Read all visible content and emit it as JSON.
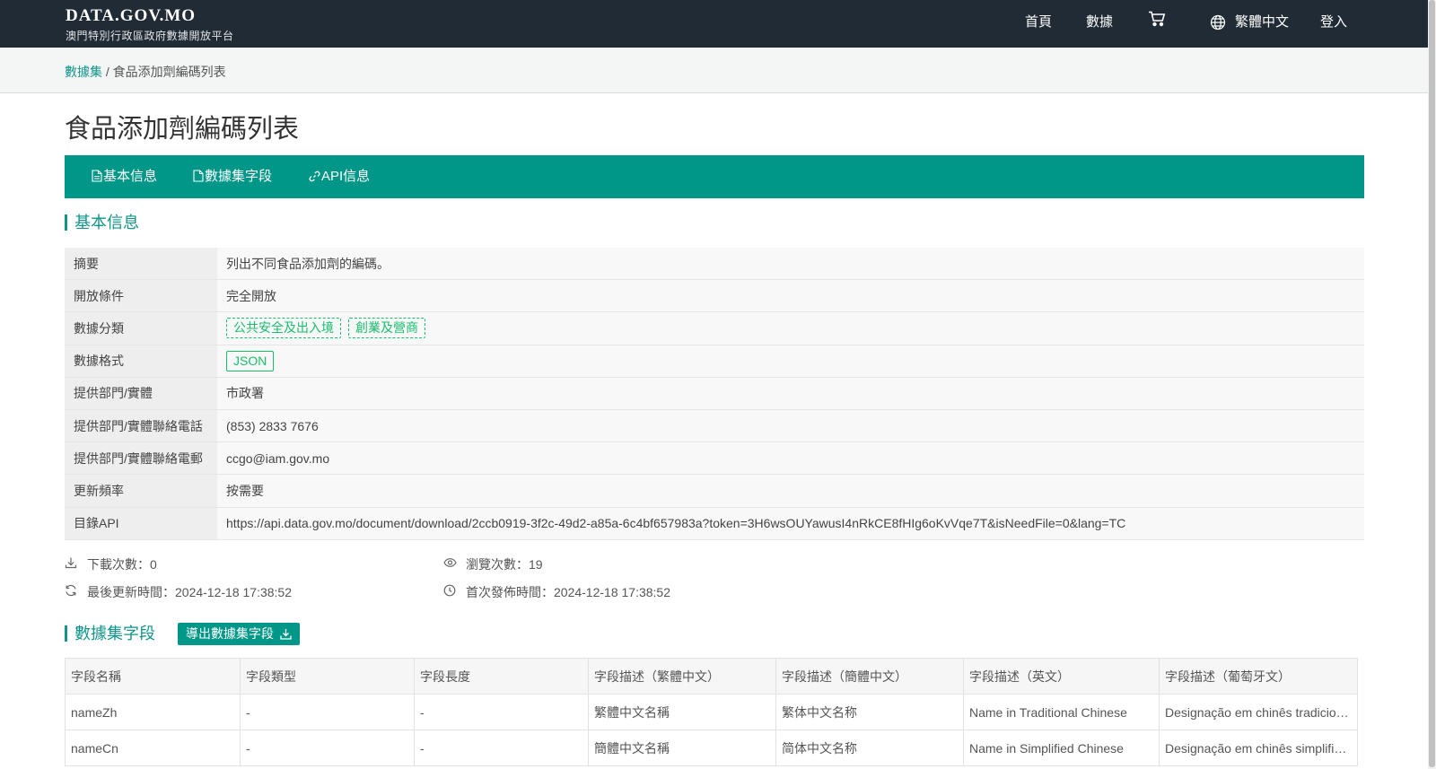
{
  "header": {
    "brand_title": "DATA.GOV.MO",
    "brand_subtitle": "澳門特別行政區政府數據開放平台",
    "nav_home": "首頁",
    "nav_data": "數據",
    "cart_icon": "cart-icon",
    "lang_icon": "globe-icon",
    "nav_lang": "繁體中文",
    "nav_login": "登入"
  },
  "breadcrumb": {
    "root": "數據集",
    "separator": " / ",
    "current": "食品添加劑編碼列表"
  },
  "page": {
    "title": "食品添加劑編碼列表"
  },
  "tabs": [
    {
      "label": "基本信息",
      "icon": "document-icon"
    },
    {
      "label": "數據集字段",
      "icon": "document-text-icon"
    },
    {
      "label": "API信息",
      "icon": "link-icon"
    }
  ],
  "basic": {
    "heading": "基本信息",
    "rows": {
      "summary": {
        "label": "摘要",
        "value": "列出不同食品添加劑的編碼。"
      },
      "condition": {
        "label": "開放條件",
        "value": "完全開放"
      },
      "category": {
        "label": "數據分類",
        "tags": [
          "公共安全及出入境",
          "創業及營商"
        ]
      },
      "format": {
        "label": "數據格式",
        "tags": [
          "JSON"
        ]
      },
      "provider": {
        "label": "提供部門/實體",
        "value": "市政署"
      },
      "phone": {
        "label": "提供部門/實體聯絡電話",
        "value": "(853) 2833 7676"
      },
      "email": {
        "label": "提供部門/實體聯絡電郵",
        "value": "ccgo@iam.gov.mo"
      },
      "frequency": {
        "label": "更新頻率",
        "value": "按需要"
      },
      "api": {
        "label": "目錄API",
        "value": "https://api.data.gov.mo/document/download/2ccb0919-3f2c-49d2-a85a-6c4bf657983a?token=3H6wsOUYawusI4nRkCE8fHIg6oKvVqe7T&isNeedFile=0&lang=TC"
      }
    }
  },
  "stats": {
    "downloads": "下載次數：0",
    "views": "瀏覽次數：19",
    "last_updated": "最後更新時間：2024-12-18 17:38:52",
    "first_published": "首次發佈時間：2024-12-18 17:38:52"
  },
  "fields": {
    "heading": "數據集字段",
    "export_label": "導出數據集字段",
    "columns": [
      "字段名稱",
      "字段類型",
      "字段長度",
      "字段描述（繁體中文）",
      "字段描述（簡體中文）",
      "字段描述（英文）",
      "字段描述（葡萄牙文）"
    ],
    "rows": [
      [
        "nameZh",
        "-",
        "-",
        "繁體中文名稱",
        "繁体中文名称",
        "Name in Traditional Chinese",
        "Designação em chinês tradicional"
      ],
      [
        "nameCn",
        "-",
        "-",
        "簡體中文名稱",
        "简体中文名称",
        "Name in Simplified Chinese",
        "Designação em chinês simplificado"
      ]
    ]
  }
}
